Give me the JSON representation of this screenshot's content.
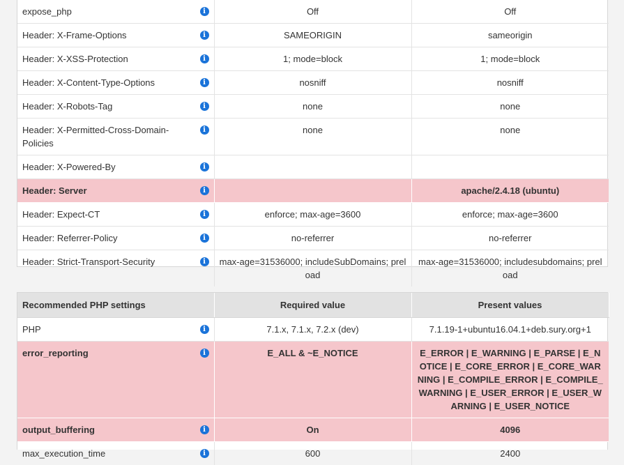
{
  "headers_table": {
    "rows": [
      {
        "name": "expose_php",
        "required": "Off",
        "present": "Off"
      },
      {
        "name": "Header: X-Frame-Options",
        "required": "SAMEORIGIN",
        "present": "sameorigin"
      },
      {
        "name": "Header: X-XSS-Protection",
        "required": "1; mode=block",
        "present": "1; mode=block"
      },
      {
        "name": "Header: X-Content-Type-Options",
        "required": "nosniff",
        "present": "nosniff"
      },
      {
        "name": "Header: X-Robots-Tag",
        "required": "none",
        "present": "none"
      },
      {
        "name": "Header: X-Permitted-Cross-Domain-Policies",
        "required": "none",
        "present": "none"
      },
      {
        "name": "Header: X-Powered-By",
        "required": "",
        "present": ""
      },
      {
        "name": "Header: Server",
        "required": "",
        "present": "apache/2.4.18 (ubuntu)",
        "status": "warning"
      },
      {
        "name": "Header: Expect-CT",
        "required": "enforce; max-age=3600",
        "present": "enforce; max-age=3600"
      },
      {
        "name": "Header: Referrer-Policy",
        "required": "no-referrer",
        "present": "no-referrer"
      },
      {
        "name": "Header: Strict-Transport-Security",
        "required": "max-age=31536000; includeSubDomains; preload",
        "present": "max-age=31536000; includesubdomains; preload"
      }
    ]
  },
  "php_table": {
    "headers": {
      "name": "Recommended PHP settings",
      "required": "Required value",
      "present": "Present values"
    },
    "rows": [
      {
        "name": "PHP",
        "required": "7.1.x, 7.1.x, 7.2.x (dev)",
        "present": "7.1.19-1+ubuntu16.04.1+deb.sury.org+1"
      },
      {
        "name": "error_reporting",
        "required": "E_ALL & ~E_NOTICE",
        "present": "E_ERROR | E_WARNING | E_PARSE | E_NOTICE | E_CORE_ERROR | E_CORE_WARNING | E_COMPILE_ERROR | E_COMPILE_WARNING | E_USER_ERROR | E_USER_WARNING | E_USER_NOTICE",
        "status": "warning"
      },
      {
        "name": "output_buffering",
        "required": "On",
        "present": "4096",
        "status": "warning"
      },
      {
        "name": "max_execution_time",
        "required": "600",
        "present": "2400"
      }
    ]
  },
  "colors": {
    "warning_row": "#f5c6cb",
    "info_icon": "#1a73d9",
    "header_bg": "#e2e2e2"
  }
}
